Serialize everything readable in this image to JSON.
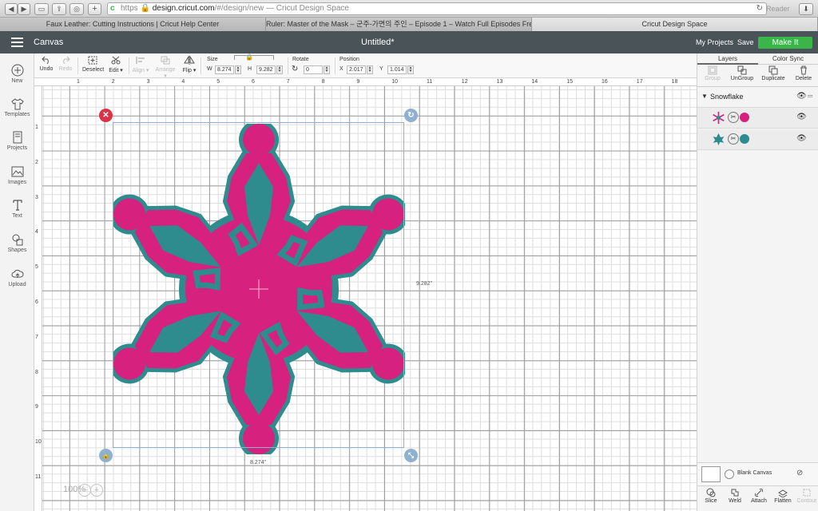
{
  "browser": {
    "url_domain": "design.cricut.com",
    "url_path": "/#/design/new",
    "url_title": " — Cricut Design Space",
    "reader_label": "Reader",
    "tabs": [
      {
        "label": "Faux Leather: Cutting Instructions | Cricut Help Center",
        "active": false
      },
      {
        "label": "Ruler: Master of the Mask – 군주-가면의 주인 – Episode 1 – Watch Full Episodes Free o...",
        "active": false
      },
      {
        "label": "Cricut Design Space",
        "active": true
      }
    ]
  },
  "header": {
    "section": "Canvas",
    "doc_title": "Untitled*",
    "my_projects": "My Projects",
    "save": "Save",
    "make_it": "Make It"
  },
  "left_bar": {
    "items": [
      {
        "label": "New",
        "icon": "plus-circle-icon"
      },
      {
        "label": "Templates",
        "icon": "tshirt-icon"
      },
      {
        "label": "Projects",
        "icon": "book-icon"
      },
      {
        "label": "Images",
        "icon": "image-icon"
      },
      {
        "label": "Text",
        "icon": "text-t-icon"
      },
      {
        "label": "Shapes",
        "icon": "shapes-icon"
      },
      {
        "label": "Upload",
        "icon": "cloud-upload-icon"
      }
    ]
  },
  "toolbar": {
    "undo": "Undo",
    "redo": "Redo",
    "deselect": "Deselect",
    "edit": "Edit",
    "align": "Align",
    "arrange": "Arrange",
    "flip": "Flip",
    "size_label": "Size",
    "w_label": "W",
    "w_value": "8.274",
    "h_label": "H",
    "h_value": "9.282",
    "rotate_label": "Rotate",
    "rotate_value": "0",
    "position_label": "Position",
    "x_label": "X",
    "x_value": "2.017",
    "y_label": "Y",
    "y_value": "1.014"
  },
  "canvas": {
    "ruler_top": [
      "1",
      "2",
      "3",
      "4",
      "5",
      "6",
      "7",
      "8",
      "9",
      "10",
      "11",
      "12",
      "13",
      "14",
      "15",
      "16",
      "17",
      "18"
    ],
    "ruler_left": [
      "1",
      "2",
      "3",
      "4",
      "5",
      "6",
      "7",
      "8",
      "9",
      "10",
      "11"
    ],
    "height_label": "9.282\"",
    "width_label": "8.274\"",
    "zoom": "100%",
    "colors": {
      "pink": "#d6227e",
      "teal": "#2e8b8e",
      "select": "#8fb0cf",
      "delete": "#d9334a"
    }
  },
  "right_panel": {
    "tabs": [
      "Layers",
      "Color Sync"
    ],
    "actions": [
      {
        "label": "Group",
        "enabled": false
      },
      {
        "label": "UnGroup",
        "enabled": true
      },
      {
        "label": "Duplicate",
        "enabled": true
      },
      {
        "label": "Delete",
        "enabled": true
      }
    ],
    "group_name": "Snowflake",
    "layers": [
      {
        "color": "#d6227e"
      },
      {
        "color": "#2e8b8e"
      }
    ],
    "blank_canvas": "Blank Canvas",
    "bottom_actions": [
      {
        "label": "Slice",
        "enabled": true
      },
      {
        "label": "Weld",
        "enabled": true
      },
      {
        "label": "Attach",
        "enabled": true
      },
      {
        "label": "Flatten",
        "enabled": true
      },
      {
        "label": "Contour",
        "enabled": false
      }
    ]
  }
}
